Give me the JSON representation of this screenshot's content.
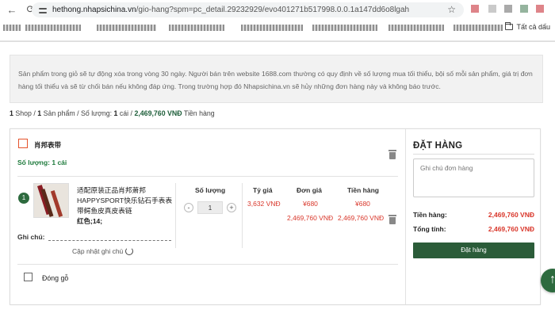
{
  "browser": {
    "url_host": "hethong.nhapsichina.vn",
    "url_path": "/gio-hang?spm=pc_detail.29232929/evo401271b517998.0.0.1a147dd6o8lgah",
    "bookmark_folder": "Tất cả dấu"
  },
  "notice": "Sản phẩm trong giỏ sẽ tự động xóa trong vòng 30 ngày. Người bán trên website 1688.com thường có quy định về số lượng mua tối thiểu, bội số mỗi sản phẩm, giá trị đơn hàng tối thiểu và sẽ từ chối bán nếu không đáp ứng. Trong trường hợp đó Nhapsichina.vn sẽ hủy những đơn hàng này và không báo trước.",
  "summary": {
    "shops_count": "1",
    "shops_label": " Shop / ",
    "products_count": "1",
    "products_label": " Sản phẩm / Số lượng: ",
    "qty_count": "1",
    "qty_unit": " cái / ",
    "total": "2,469,760 VNĐ",
    "total_label": " Tiền hàng"
  },
  "shop": {
    "name": "肖邦表带",
    "qty_text": "Số lượng: 1 cái"
  },
  "item": {
    "index": "1",
    "name": "适配原装正品肖邦萧邦HAPPYSPORT快乐钻石手表表带鳄鱼皮真皮表链",
    "variant": "红色;14;",
    "note_label": "Ghi chú:",
    "update_note": "Cập nhật ghi chú",
    "qty_value": "1",
    "rate": "3,632 VNĐ",
    "unit_price_cny": "¥680",
    "unit_price_vnd": "2,469,760 VNĐ",
    "amount_cny": "¥680",
    "amount_vnd": "2,469,760 VNĐ"
  },
  "columns": {
    "qty": "Số lượng",
    "rate": "Tỷ giá",
    "unit_price": "Đơn giá",
    "amount": "Tiền hàng"
  },
  "order": {
    "title": "ĐẶT HÀNG",
    "note_placeholder": "Ghi chú đơn hàng",
    "subtotal_label": "Tiền hàng:",
    "subtotal_value": "2,469,760 VNĐ",
    "total_label": "Tổng tính:",
    "total_value": "2,469,760 VNĐ",
    "button": "Đặt hàng"
  },
  "packing_label": "Đóng gỗ",
  "colors": {
    "brand_green": "#2b5c39",
    "price_red": "#d9372b",
    "checkbox_orange": "#e5532c"
  },
  "icons": [
    "back-icon",
    "reload-icon",
    "tune-icon",
    "star-icon",
    "trash-icon",
    "refresh-icon",
    "folder-icon",
    "fab-icon"
  ]
}
